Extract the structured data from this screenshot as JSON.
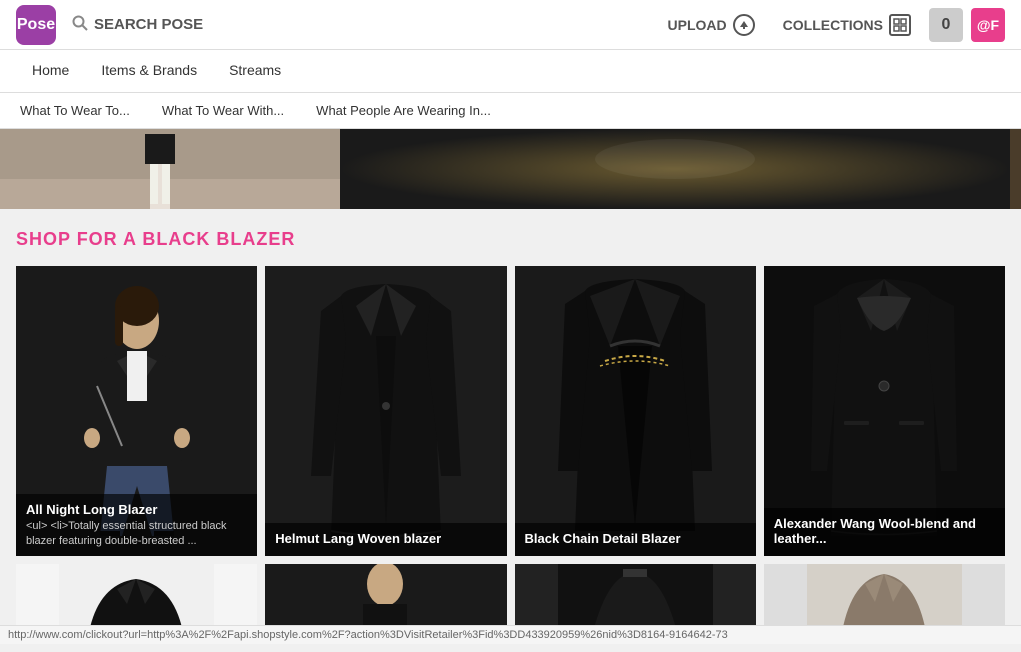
{
  "header": {
    "logo_text": "Pose",
    "search_label": "SEARCH POSE",
    "upload_label": "UPLOAD",
    "collections_label": "COLLECTIONS",
    "count": "0",
    "user_handle": "@F"
  },
  "nav": {
    "items": [
      {
        "label": "Home",
        "active": false
      },
      {
        "label": "Items & Brands",
        "active": false
      },
      {
        "label": "Streams",
        "active": false
      }
    ]
  },
  "sub_nav": {
    "items": [
      {
        "label": "What To Wear To..."
      },
      {
        "label": "What To Wear With..."
      },
      {
        "label": "What People Are Wearing In..."
      }
    ]
  },
  "shop_section": {
    "title": "SHOP FOR A BLACK BLAZER"
  },
  "products": [
    {
      "title": "All Night Long Blazer",
      "description": "<ul> <li>Totally essential structured black blazer featuring double-breasted ...",
      "bg": "dark"
    },
    {
      "title": "Helmut Lang Woven blazer",
      "description": "",
      "bg": "black"
    },
    {
      "title": "Black Chain Detail Blazer",
      "description": "",
      "bg": "dark"
    },
    {
      "title": "Alexander Wang Wool-blend and leather...",
      "description": "",
      "bg": "black"
    }
  ],
  "status_bar": {
    "url": "http://www.com/clickout?url=http%3A%2F%2Fapi.shopstyle.com%2F?action%3DVisitRetailer%3Fid%3DD433920959%26nid%3D8164-9164642-73"
  }
}
